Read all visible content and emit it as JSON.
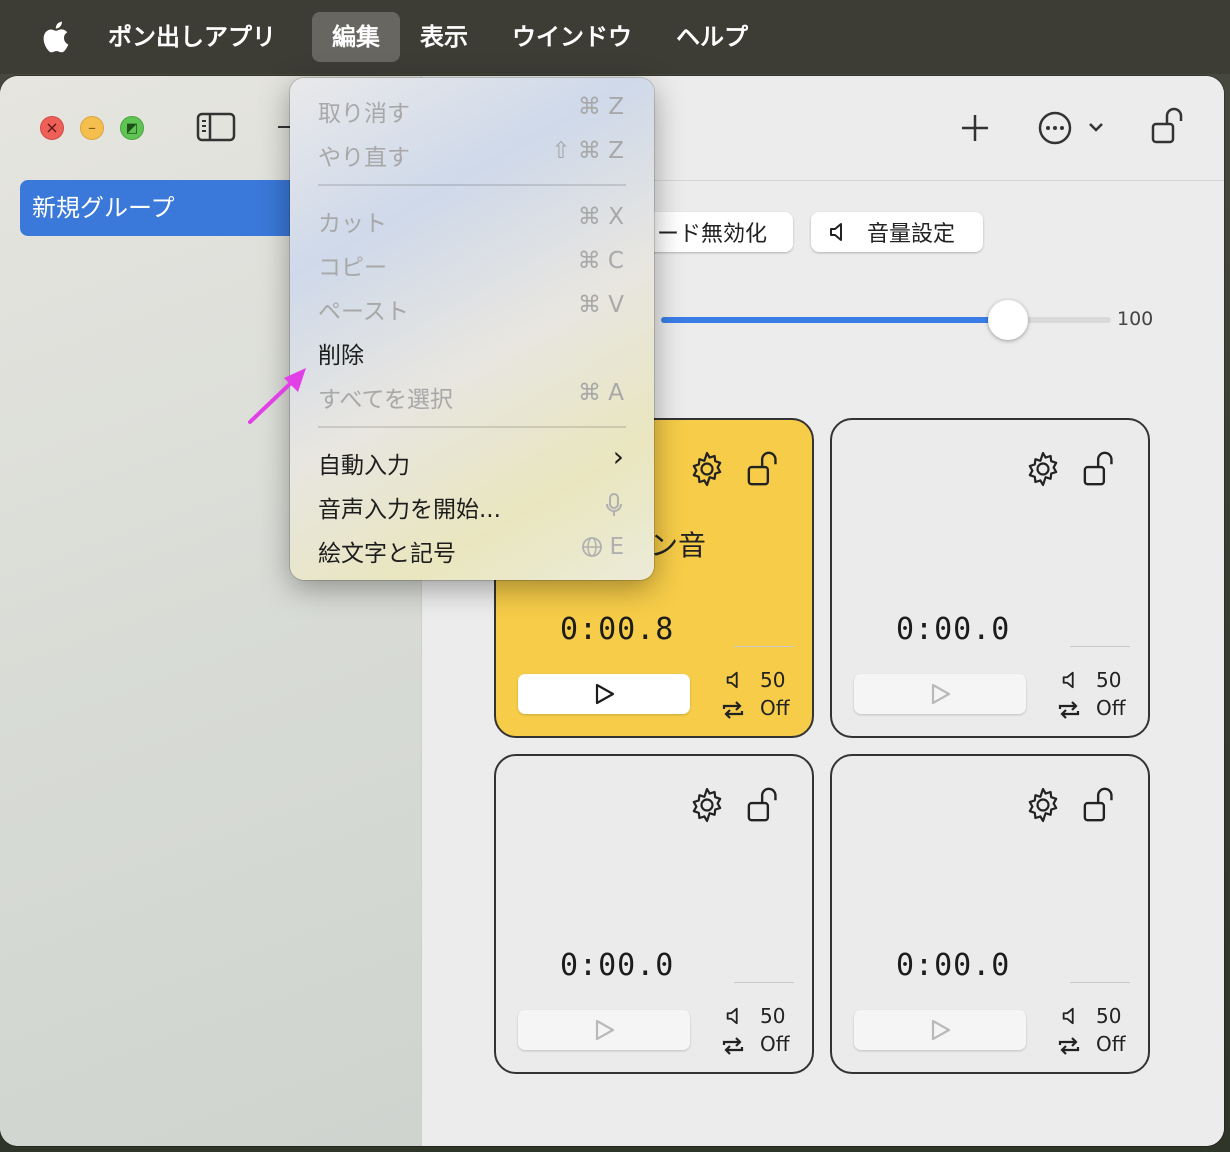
{
  "menubar": {
    "app_name": "ポン出しアプリ",
    "items": [
      "編集",
      "表示",
      "ウインドウ",
      "ヘルプ"
    ],
    "active_item": "編集"
  },
  "sidebar": {
    "selected_group": "新規グループ"
  },
  "toolbar": {
    "add_icon": "plus-icon",
    "more_icon": "ellipsis-circle-icon",
    "lock_icon": "unlock-icon"
  },
  "controls": {
    "mode_disable_label": "ード無効化",
    "volume_setting_label": "音量設定",
    "master_volume_value": "100",
    "master_volume_level": 0.77
  },
  "cards": [
    {
      "name": "ン音",
      "time": "0:00.8",
      "volume": "50",
      "loop": "Off",
      "playing": true
    },
    {
      "name": "",
      "time": "0:00.0",
      "volume": "50",
      "loop": "Off",
      "playing": false
    },
    {
      "name": "",
      "time": "0:00.0",
      "volume": "50",
      "loop": "Off",
      "playing": false
    },
    {
      "name": "",
      "time": "0:00.0",
      "volume": "50",
      "loop": "Off",
      "playing": false
    }
  ],
  "edit_menu": {
    "undo": {
      "label": "取り消す",
      "shortcut": "⌘ Z"
    },
    "redo": {
      "label": "やり直す",
      "shortcut": "⇧ ⌘ Z"
    },
    "cut": {
      "label": "カット",
      "shortcut": "⌘ X"
    },
    "copy": {
      "label": "コピー",
      "shortcut": "⌘ C"
    },
    "paste": {
      "label": "ペースト",
      "shortcut": "⌘ V"
    },
    "delete": {
      "label": "削除"
    },
    "select_all": {
      "label": "すべてを選択",
      "shortcut": "⌘ A"
    },
    "autofill": {
      "label": "自動入力",
      "shortcut": "›"
    },
    "dictation": {
      "label": "音声入力を開始..."
    },
    "emoji": {
      "label": "絵文字と記号",
      "shortcut": "E"
    }
  },
  "colors": {
    "accent": "#3b7de6",
    "selection": "#3a78d9",
    "playing_card": "#f6cc48",
    "annotation_arrow": "#e040e6"
  }
}
